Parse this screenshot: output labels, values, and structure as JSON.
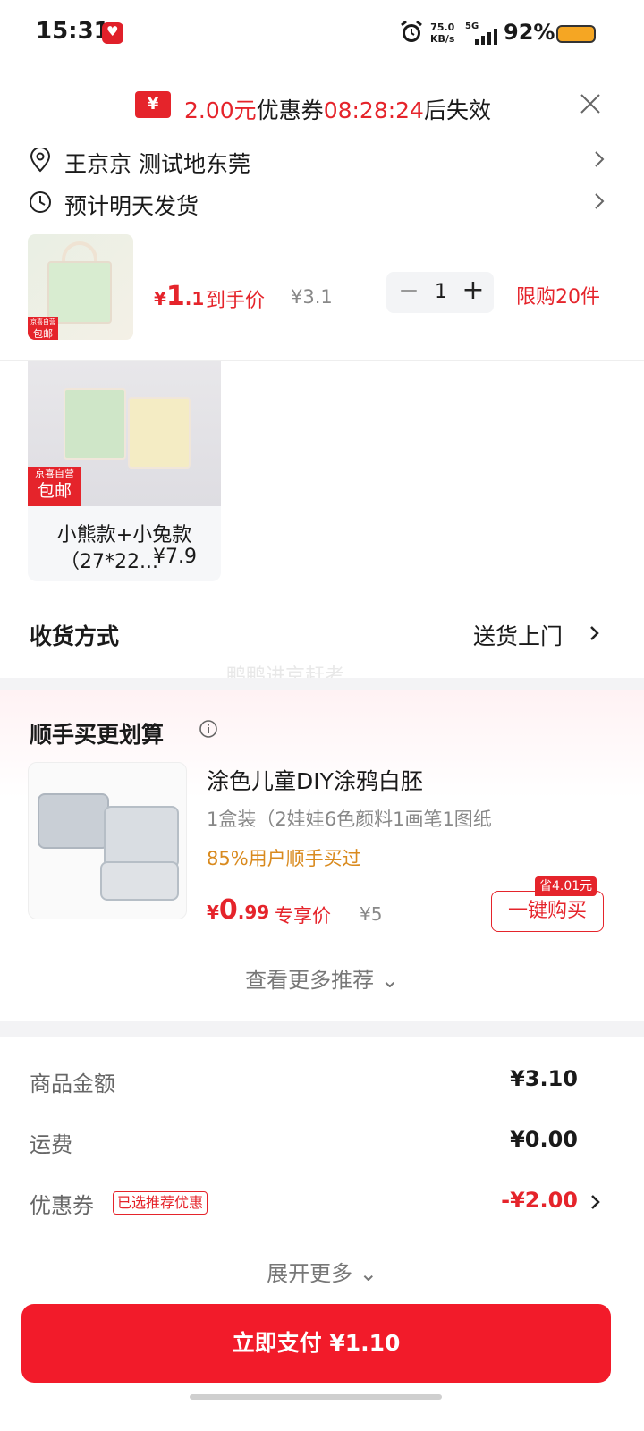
{
  "status_bar": {
    "time": "15:31",
    "net_speed_value": "75.0",
    "net_speed_unit": "KB/s",
    "network": "5G",
    "battery": "92%"
  },
  "coupon_banner": {
    "icon_symbol": "¥",
    "amount": "2.00元",
    "label": "优惠券",
    "countdown": "08:28:24",
    "suffix": "后失效"
  },
  "address": {
    "text": "王京京  测试地东莞"
  },
  "shipping_estimate": {
    "text": "预计明天发货"
  },
  "product": {
    "badge_top": "京喜自营",
    "badge_main": "包邮",
    "price_currency": "¥",
    "price_integer": "1",
    "price_decimal": ".1",
    "price_label": "到手价",
    "original_price": "¥3.1",
    "quantity": "1",
    "limit": "限购20件"
  },
  "variant": {
    "badge_top": "京喜自营",
    "badge_main": "包邮",
    "name": "小熊款+小兔款",
    "desc": "（27*22...",
    "price": "¥7.9"
  },
  "delivery": {
    "label": "收货方式",
    "value": "送货上门"
  },
  "watermark": "鸭鸭进京赶考",
  "recommendation": {
    "title": "顺手买更划算",
    "item_name": "涂色儿童DIY涂鸦白胚",
    "item_spec": "1盒装（2娃娃6色颜料1画笔1图纸",
    "social_proof": "85%用户顺手买过",
    "price_currency": "¥",
    "price_integer": "0",
    "price_decimal": ".99",
    "price_label": "专享价",
    "original_price": "¥5",
    "save_tag": "省4.01元",
    "buy_button": "一键购买",
    "more_link": "查看更多推荐 ⌄"
  },
  "summary": {
    "goods_label": "商品金额",
    "goods_value": "¥3.10",
    "shipping_label": "运费",
    "shipping_value": "¥0.00",
    "coupon_label": "优惠券",
    "coupon_chip": "已选推荐优惠",
    "coupon_value": "-¥2.00",
    "expand_more": "展开更多 ⌄"
  },
  "pay_button": "立即支付 ¥1.10",
  "colors": {
    "accent": "#e5242b",
    "pay_button": "#f21b2a",
    "social_proof": "#d98a1e"
  },
  "icons": [
    "alarm-icon",
    "signal-icon",
    "battery-icon",
    "coupon-icon",
    "close-icon",
    "location-pin-icon",
    "clock-icon",
    "chevron-right-icon",
    "info-icon",
    "minus-icon",
    "plus-icon"
  ]
}
